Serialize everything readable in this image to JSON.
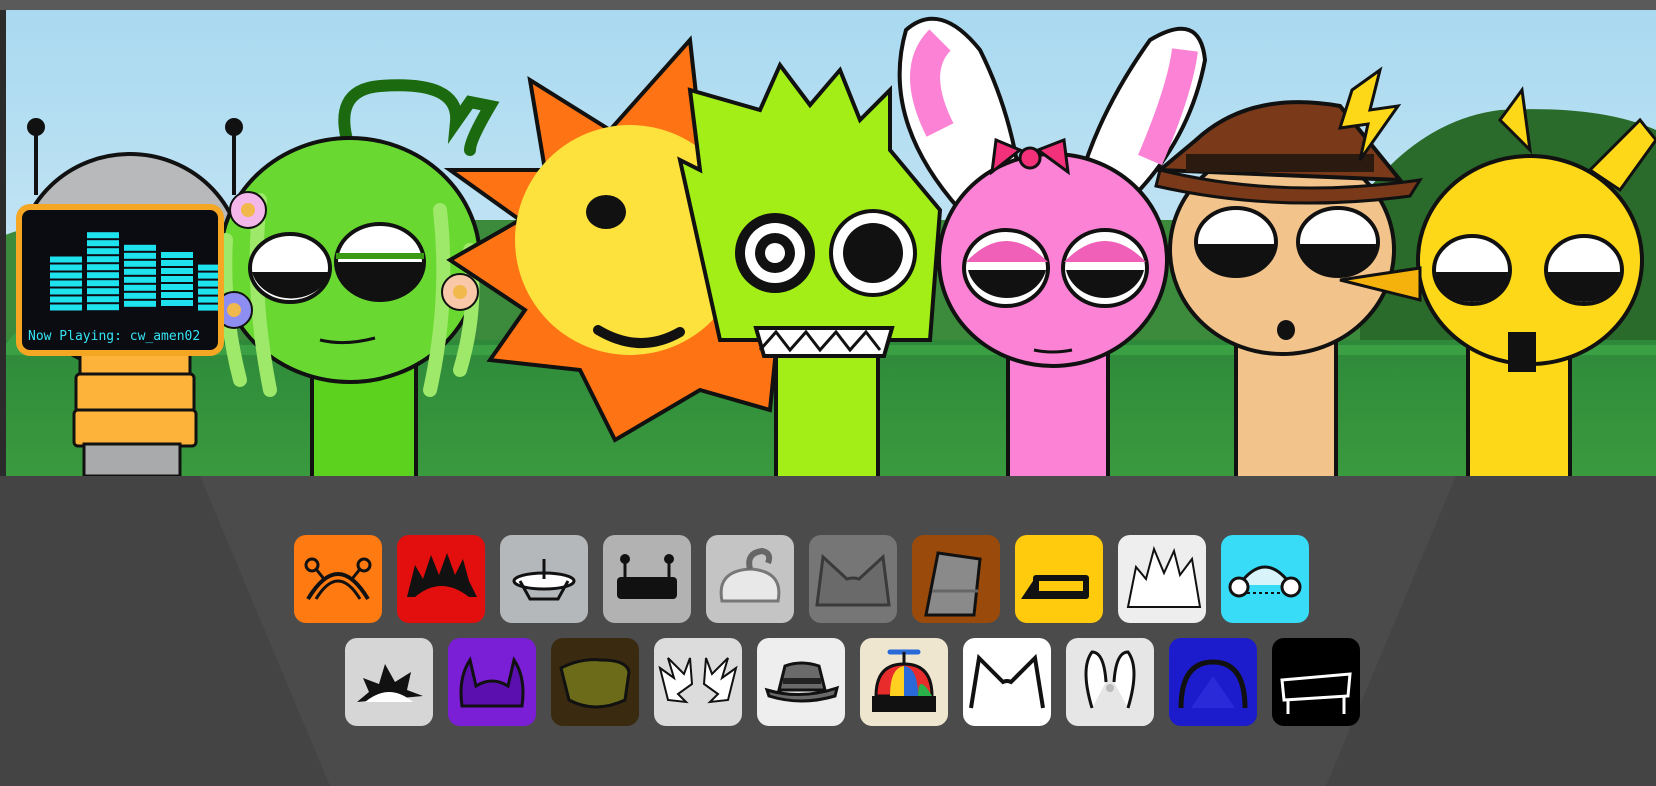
{
  "radio": {
    "prefix": "Now Playing: ",
    "track": "cw_amen02",
    "equalizer_levels": [
      0.55,
      0.82,
      0.68,
      0.6,
      0.46
    ]
  },
  "stage_characters": [
    {
      "name": "radio-robot",
      "color": "#b7b9bb"
    },
    {
      "name": "green-vine-girl",
      "color": "#5cd11e"
    },
    {
      "name": "orange-sun",
      "color": "#fde13d"
    },
    {
      "name": "lime-spiky",
      "color": "#a3ee17"
    },
    {
      "name": "pink-bunny",
      "color": "#fb82d4"
    },
    {
      "name": "tan-fedora",
      "color": "#f2c48b"
    },
    {
      "name": "yellow-bird",
      "color": "#fdd818"
    }
  ],
  "hat_picker": {
    "row1": [
      {
        "icon": "orange-antenna-headband-icon",
        "bg": "#ff7b12"
      },
      {
        "icon": "red-spiky-crown-icon",
        "bg": "#e30e0e"
      },
      {
        "icon": "ufo-dome-icon",
        "bg": "#b5b8bb"
      },
      {
        "icon": "black-robot-antenna-icon",
        "bg": "#b2b2b2"
      },
      {
        "icon": "grey-pumpkin-icon",
        "bg": "#c4c4c4"
      },
      {
        "icon": "grey-cat-ears-icon",
        "bg": "#767676"
      },
      {
        "icon": "grey-bucket-icon",
        "bg": "#9a4a0a"
      },
      {
        "icon": "yellow-hard-hat-icon",
        "bg": "#ffcb0c"
      },
      {
        "icon": "white-spiky-hair-icon",
        "bg": "#eeeeee"
      },
      {
        "icon": "blue-headphones-icon",
        "bg": "#38dcf6"
      }
    ],
    "row2": [
      {
        "icon": "white-burst-hair-icon",
        "bg": "#d6d6d6"
      },
      {
        "icon": "purple-horns-icon",
        "bg": "#7a1fd6"
      },
      {
        "icon": "brown-moss-hair-icon",
        "bg": "#3a2a10"
      },
      {
        "icon": "lightning-spikes-icon",
        "bg": "#dcdcdc"
      },
      {
        "icon": "fedora-hat-icon",
        "bg": "#eeeeee"
      },
      {
        "icon": "propeller-cap-icon",
        "bg": "#efe6d0"
      },
      {
        "icon": "white-cat-ears-icon",
        "bg": "#ffffff"
      },
      {
        "icon": "white-bunny-ears-icon",
        "bg": "#e6e6e6"
      },
      {
        "icon": "blue-dome-helmet-icon",
        "bg": "#1c1ccc"
      },
      {
        "icon": "bench-outline-icon",
        "bg": "#000000"
      }
    ]
  }
}
